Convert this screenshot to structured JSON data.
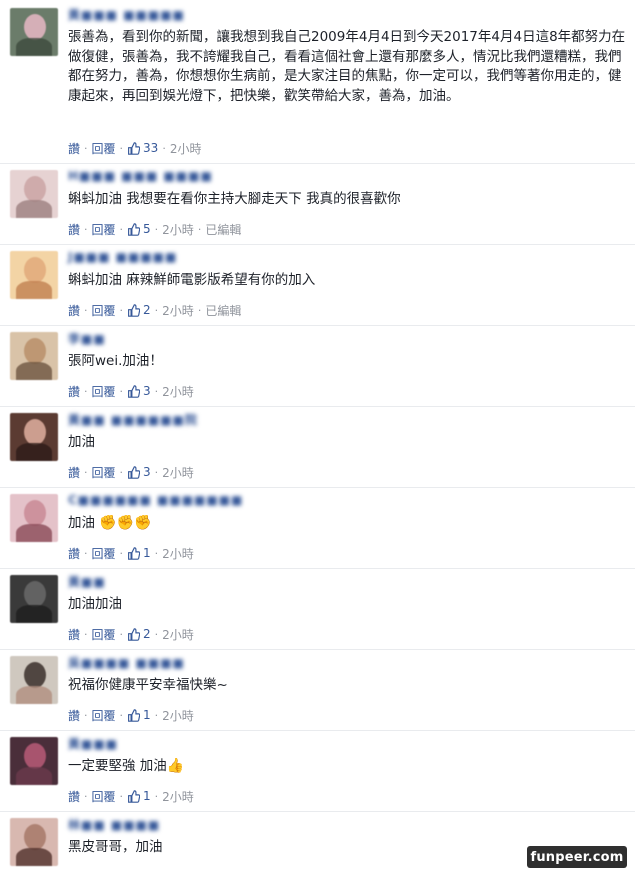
{
  "actions": {
    "like_label": "讚",
    "reply_label": "回覆",
    "edited_label": "已編輯"
  },
  "colors": {
    "link": "#365899",
    "meta": "#90949c",
    "divider": "#e9ebee"
  },
  "comments": [
    {
      "name": "黃■■■ ■■■■■",
      "text": "張善為，看到你的新聞，讓我想到我自己2009年4月4日到今天2017年4月4日這8年都努力在做復健，張善為，我不誇耀我自己，看看這個社會上還有那麼多人，情況比我們還糟糕，我們都在努力，善為，你想想你生病前，是大家注目的焦點，你一定可以，我們等著你用走的，健康起來，再回到娛光燈下，把快樂，歡笑帶給大家，善為，加油。",
      "likes": "33",
      "time": "2小時",
      "edited": "",
      "emoji": ""
    },
    {
      "name": "H■■■ ■■■ ■■■■",
      "text": "蝌蚪加油 我想要在看你主持大腳走天下 我真的很喜歡你",
      "likes": "5",
      "time": "2小時",
      "edited": "已編輯",
      "emoji": ""
    },
    {
      "name": "J■■■ ■■■■■",
      "text": "蝌蚪加油 麻辣鮮師電影版希望有你的加入",
      "likes": "2",
      "time": "2小時",
      "edited": "已編輯",
      "emoji": ""
    },
    {
      "name": "李■■",
      "text": "張阿wei.加油！",
      "likes": "3",
      "time": "2小時",
      "edited": "",
      "emoji": ""
    },
    {
      "name": "黃■■ ■■■■■■院",
      "text": "加油",
      "likes": "3",
      "time": "2小時",
      "edited": "",
      "emoji": ""
    },
    {
      "name": "C■■■■■■ ■■■■■■■",
      "text": "加油",
      "likes": "1",
      "time": "2小時",
      "edited": "",
      "emoji": "✊✊✊"
    },
    {
      "name": "黃■■",
      "text": "加油加油",
      "likes": "2",
      "time": "2小時",
      "edited": "",
      "emoji": ""
    },
    {
      "name": "吳■■■■ ■■■■",
      "text": "祝福你健康平安幸福快樂~",
      "likes": "1",
      "time": "2小時",
      "edited": "",
      "emoji": ""
    },
    {
      "name": "黃■■■",
      "text": "一定要堅強 加油",
      "likes": "1",
      "time": "2小時",
      "edited": "",
      "emoji": "👍"
    },
    {
      "name": "林■■ ■■■■",
      "text": "黑皮哥哥，加油",
      "likes": "",
      "time": "",
      "edited": "",
      "emoji": ""
    }
  ],
  "watermark": "funpeer.com"
}
